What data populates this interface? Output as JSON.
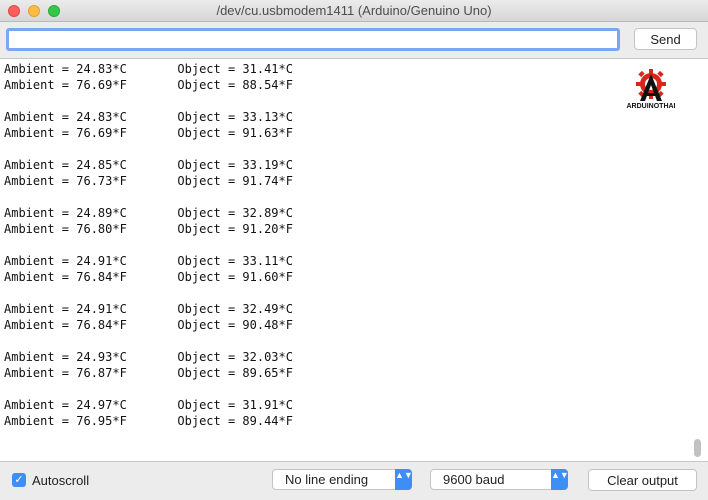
{
  "window": {
    "title": "/dev/cu.usbmodem1411 (Arduino/Genuino Uno)"
  },
  "toolbar": {
    "input_value": "",
    "send_label": "Send"
  },
  "output": {
    "lines": [
      "Ambient = 24.83*C       Object = 31.41*C",
      "Ambient = 76.69*F       Object = 88.54*F",
      "",
      "Ambient = 24.83*C       Object = 33.13*C",
      "Ambient = 76.69*F       Object = 91.63*F",
      "",
      "Ambient = 24.85*C       Object = 33.19*C",
      "Ambient = 76.73*F       Object = 91.74*F",
      "",
      "Ambient = 24.89*C       Object = 32.89*C",
      "Ambient = 76.80*F       Object = 91.20*F",
      "",
      "Ambient = 24.91*C       Object = 33.11*C",
      "Ambient = 76.84*F       Object = 91.60*F",
      "",
      "Ambient = 24.91*C       Object = 32.49*C",
      "Ambient = 76.84*F       Object = 90.48*F",
      "",
      "Ambient = 24.93*C       Object = 32.03*C",
      "Ambient = 76.87*F       Object = 89.65*F",
      "",
      "Ambient = 24.97*C       Object = 31.91*C",
      "Ambient = 76.95*F       Object = 89.44*F"
    ],
    "watermark_text": "ARDUINOTHAI"
  },
  "bottom": {
    "autoscroll_label": "Autoscroll",
    "autoscroll_checked": true,
    "line_ending": "No line ending",
    "baud": "9600 baud",
    "clear_label": "Clear output",
    "select_arrow": "▲▼",
    "check_glyph": "✓"
  },
  "colors": {
    "accent": "#3d8ef7",
    "focus_ring": "#7aa8ee",
    "logo_red": "#d9261c"
  },
  "icons": {
    "close": "close-icon",
    "minimize": "minimize-icon",
    "maximize": "maximize-icon",
    "select_arrows": "up-down-chevron-icon",
    "checkbox": "checkmark-icon",
    "logo": "arduinothai-gear-logo-icon"
  }
}
